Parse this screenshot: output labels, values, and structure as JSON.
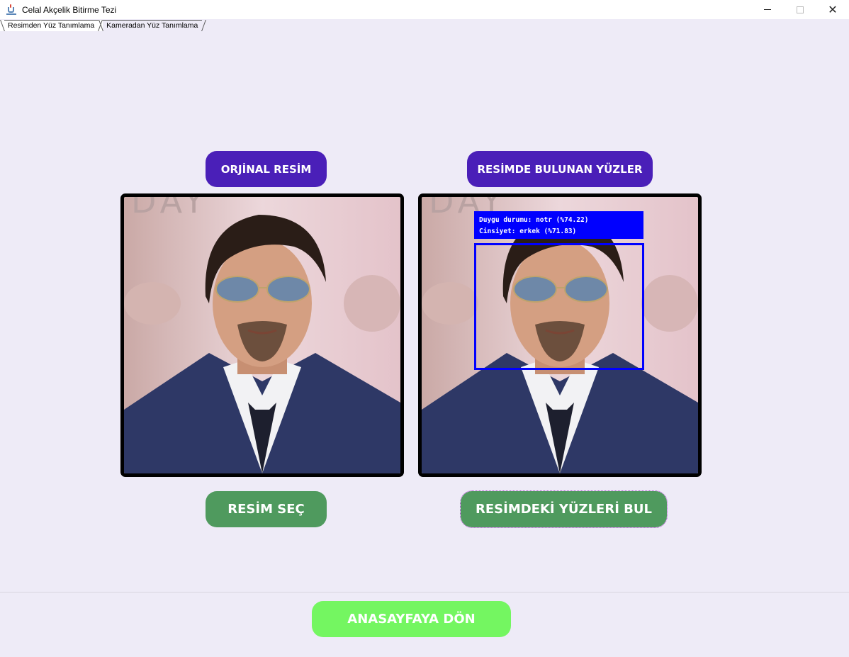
{
  "window": {
    "title": "Celal Akçelik Bitirme Tezi",
    "icon": "java-cup-icon",
    "controls": {
      "minimize": "minimize-icon",
      "maximize": "maximize-icon",
      "close": "✕"
    }
  },
  "tabs": [
    {
      "label": "Resimden Yüz Tanımlama",
      "active": true
    },
    {
      "label": "Kameradan Yüz Tanımlama",
      "active": false
    }
  ],
  "left_panel": {
    "header": "ORJİNAL RESİM",
    "button": "RESİM SEÇ"
  },
  "right_panel": {
    "header": "RESİMDE BULUNAN YÜZLER",
    "button": "RESİMDEKİ YÜZLERİ BUL",
    "detection": {
      "emotion_line": "Duygu durumu: notr (%74.22)",
      "gender_line": "Cinsiyet: erkek (%71.83)",
      "box_color": "#0000ff"
    }
  },
  "footer": {
    "home_button": "ANASAYFAYA DÖN"
  },
  "colors": {
    "background": "#eeebf7",
    "header_purple": "#4a1fb8",
    "action_green": "#4f9a5e",
    "home_lime": "#74f661"
  }
}
